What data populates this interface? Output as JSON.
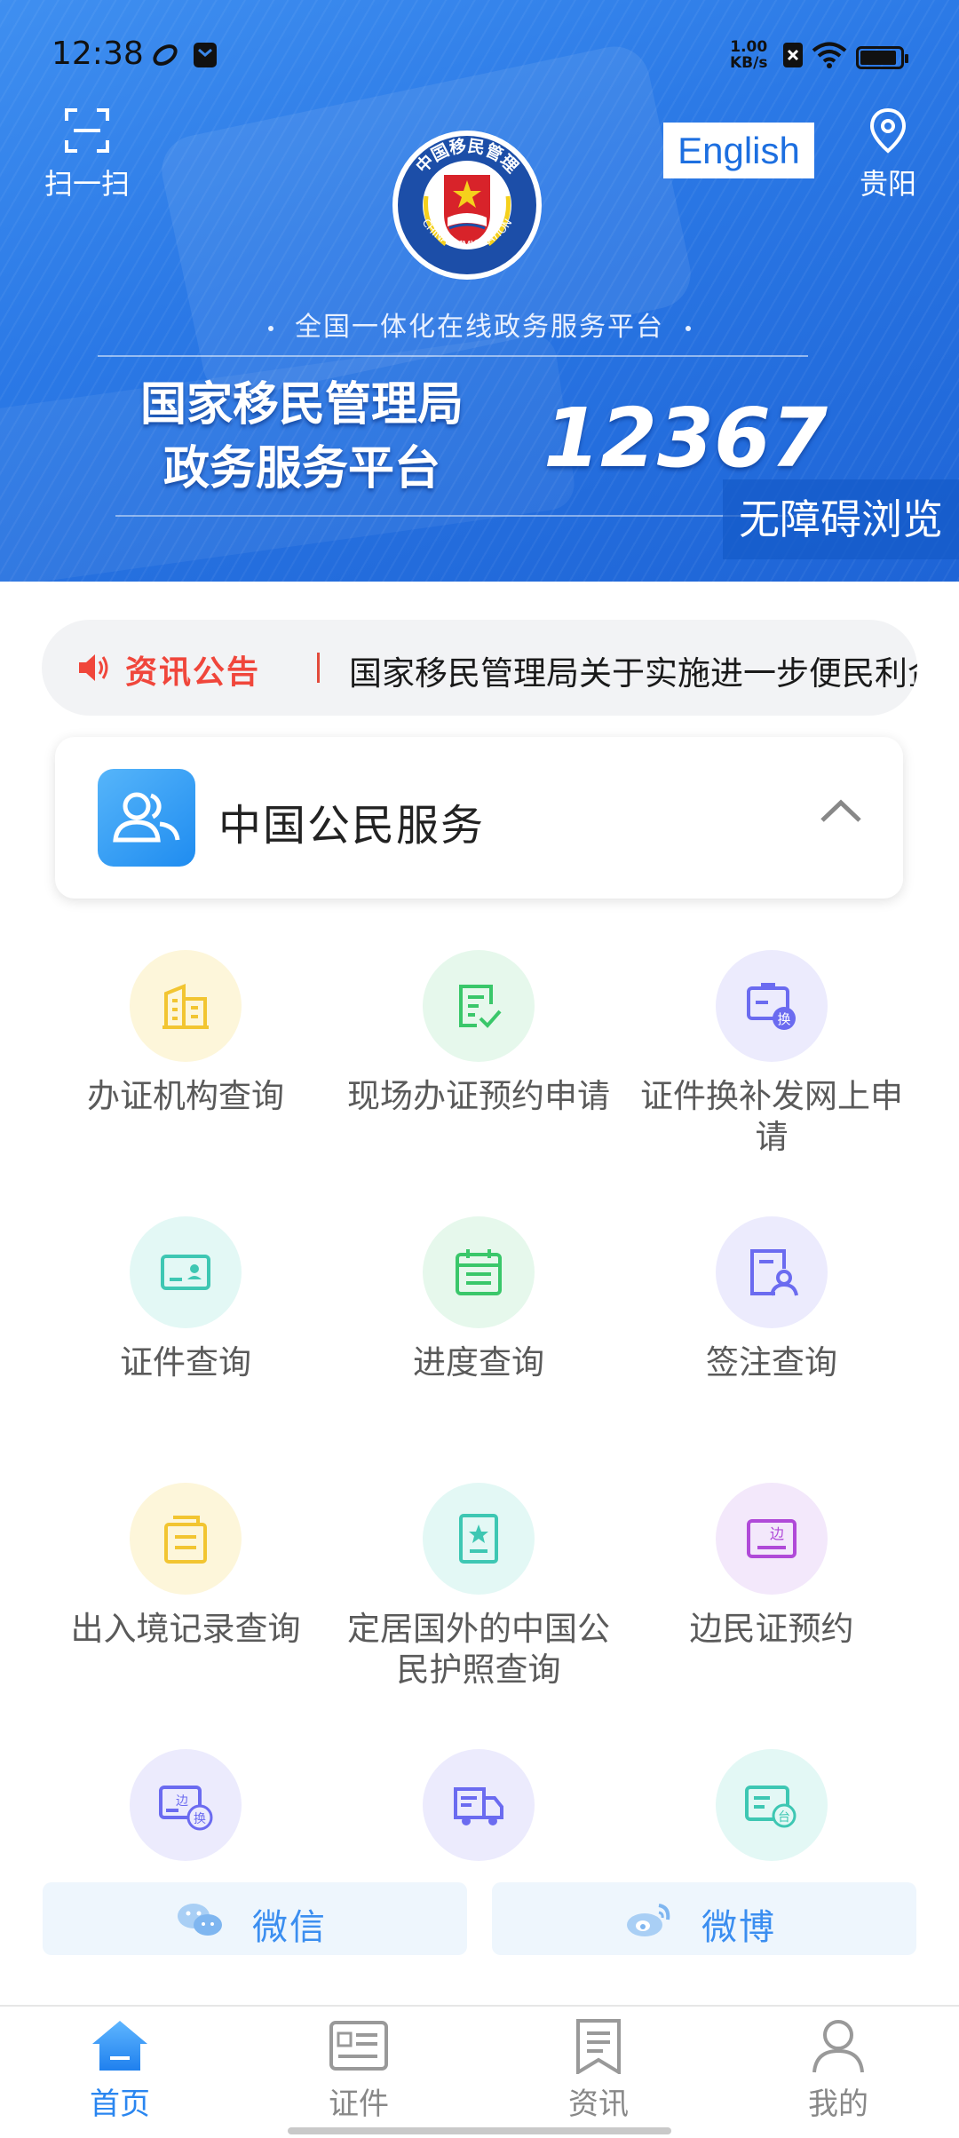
{
  "status_bar": {
    "time": "12:38",
    "net_speed_value": "1.00",
    "net_speed_unit": "KB/s"
  },
  "header": {
    "scan_label": "扫一扫",
    "language_button": "English",
    "location_label": "贵阳",
    "emblem_text_cn": "中国移民管理",
    "emblem_text_en": "CHINA IMMIGRATION",
    "tagline": "全国一体化在线政务服务平台",
    "title_line1": "国家移民管理局",
    "title_line2": "政务服务平台",
    "hotline": "12367",
    "accessible_button": "无障碍浏览"
  },
  "notice": {
    "tag": "资讯公告",
    "text": "国家移民管理局关于实施进一步便民利企"
  },
  "service_section": {
    "title": "中国公民服务",
    "expanded": true
  },
  "services": [
    {
      "label": "办证机构查询",
      "icon": "building-icon",
      "color": "#f2c531"
    },
    {
      "label": "现场办证预约申请",
      "icon": "form-check-icon",
      "color": "#3ac76a"
    },
    {
      "label": "证件换补发网上申请",
      "icon": "passport-exchange-icon",
      "color": "#6b6bf0"
    },
    {
      "label": "证件查询",
      "icon": "id-card-icon",
      "color": "#3ec7b3"
    },
    {
      "label": "进度查询",
      "icon": "calendar-icon",
      "color": "#3ac76a"
    },
    {
      "label": "签注查询",
      "icon": "endorsement-icon",
      "color": "#6b6bf0"
    },
    {
      "label": "出入境记录查询",
      "icon": "record-box-icon",
      "color": "#f2c531"
    },
    {
      "label": "定居国外的中国公民护照查询",
      "icon": "passport-star-icon",
      "color": "#3ec7b3"
    },
    {
      "label": "边民证预约",
      "icon": "border-card-icon",
      "color": "#b04ad8"
    },
    {
      "label": "",
      "icon": "border-exchange-icon",
      "color": "#6b6bf0"
    },
    {
      "label": "",
      "icon": "truck-icon",
      "color": "#6b6bf0"
    },
    {
      "label": "",
      "icon": "taiwan-card-icon",
      "color": "#3ec7b3"
    }
  ],
  "social": {
    "wechat": "微信",
    "weibo": "微博"
  },
  "tabbar": [
    {
      "label": "首页",
      "active": true
    },
    {
      "label": "证件",
      "active": false
    },
    {
      "label": "资讯",
      "active": false
    },
    {
      "label": "我的",
      "active": false
    }
  ],
  "colors": {
    "accent": "#2a86f0",
    "notice_red": "#f0463b",
    "banner_blue": "#2b79e6"
  }
}
